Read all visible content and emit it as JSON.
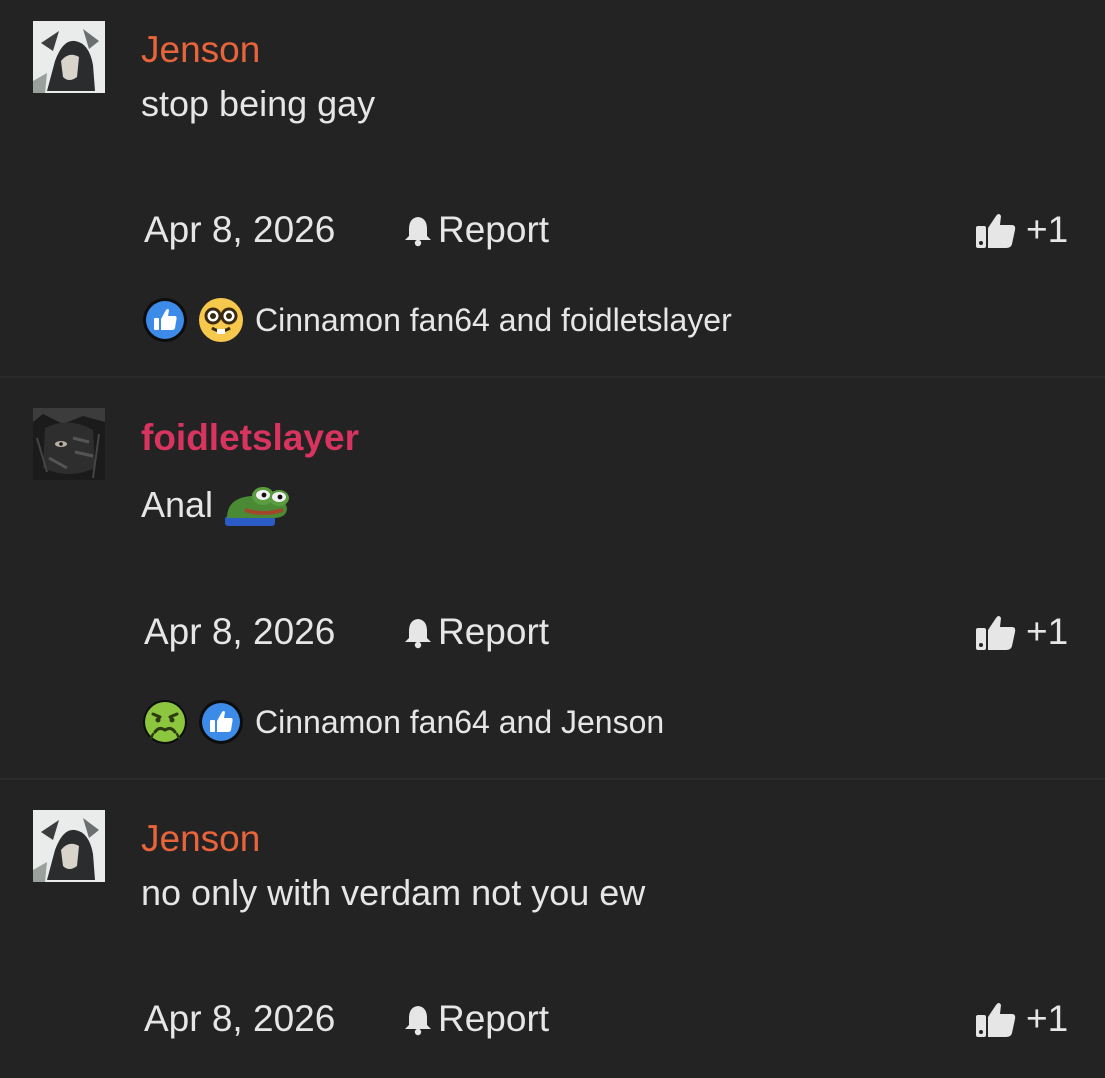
{
  "comments": [
    {
      "username": "Jenson",
      "username_color": "#e8643a",
      "avatar": "anime-avatar-light",
      "message": "stop being gay",
      "emote": null,
      "date": "Apr 8, 2026",
      "report_label": "Report",
      "like_count": "+1",
      "reactions": [
        "thumbs-up-reaction",
        "nerd-face-reaction"
      ],
      "reaction_text": "Cinnamon fan64 and foidletslayer"
    },
    {
      "username": "foidletslayer",
      "username_color": "#d8345f",
      "avatar": "dark-manga-avatar",
      "message": "Anal",
      "emote": "pepe-frog-emote",
      "date": "Apr 8, 2026",
      "report_label": "Report",
      "like_count": "+1",
      "reactions": [
        "nauseated-face-reaction",
        "thumbs-up-reaction"
      ],
      "reaction_text": "Cinnamon fan64 and Jenson"
    },
    {
      "username": "Jenson",
      "username_color": "#e8643a",
      "avatar": "anime-avatar-light",
      "message": "no only with verdam not you ew",
      "emote": null,
      "date": "Apr 8, 2026",
      "report_label": "Report",
      "like_count": "+1",
      "reactions": [],
      "reaction_text": ""
    }
  ],
  "colors": {
    "background": "#232323",
    "text": "#e6e6e6",
    "divider": "#2b2b2b",
    "like_blue": "#3d8be8"
  }
}
